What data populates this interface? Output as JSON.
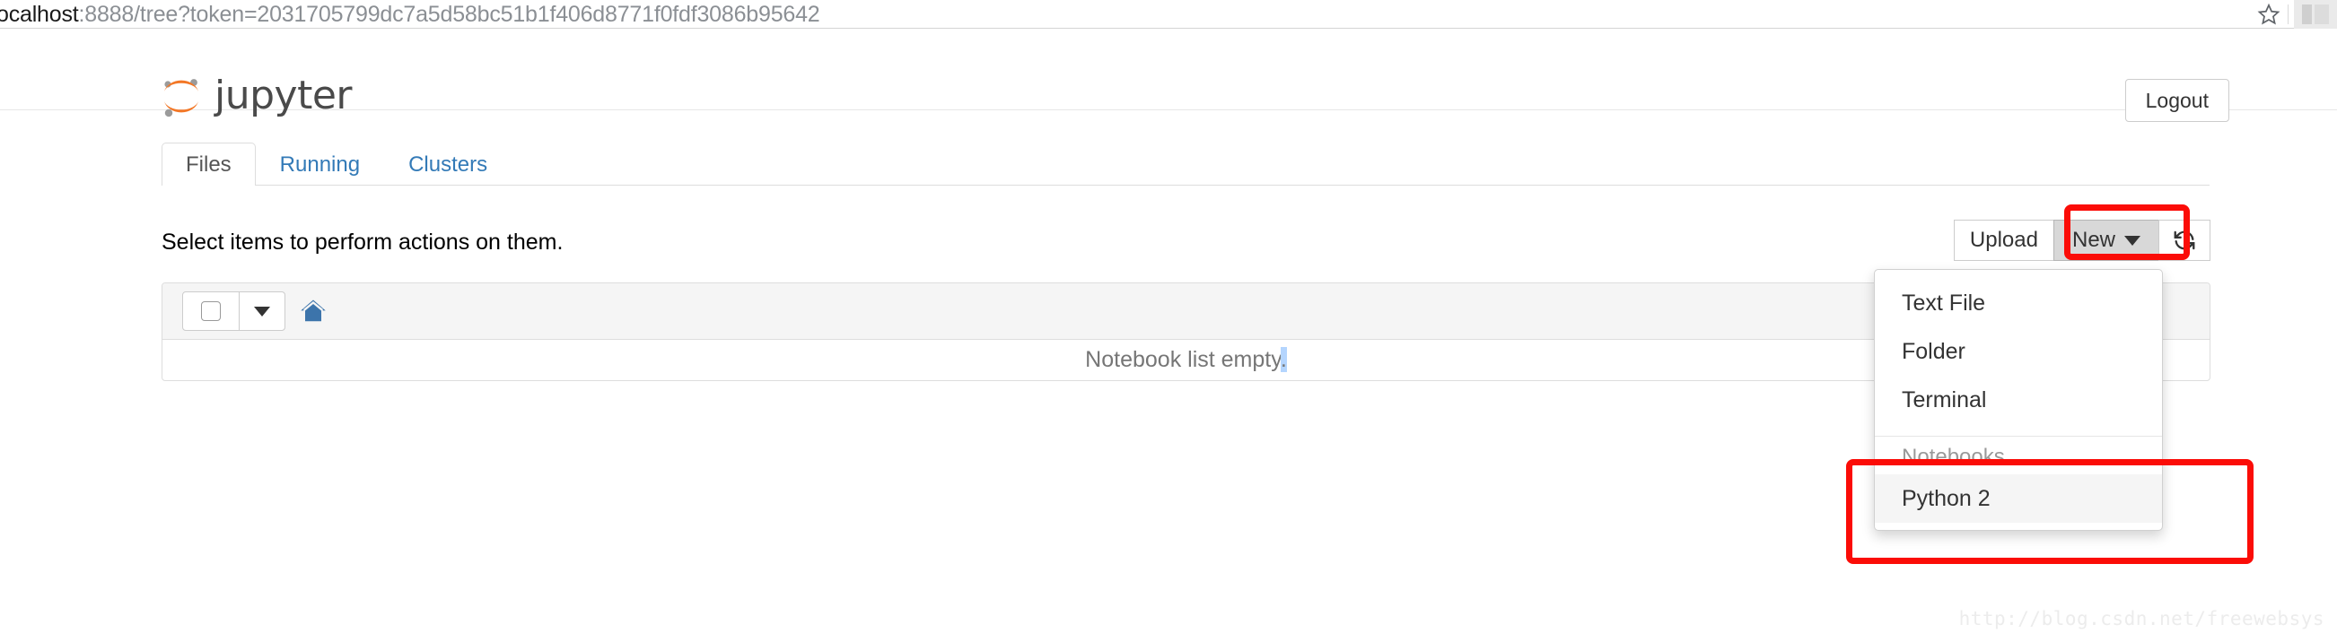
{
  "browser": {
    "url_host": "ocalhost",
    "url_rest": ":8888/tree?token=2031705799dc7a5d58bc51b1f406d8771f0fdf3086b95642",
    "star_icon": "star-icon",
    "panel_icon": "browser-panel-icon"
  },
  "header": {
    "brand": "jupyter",
    "logo_icon": "jupyter-logo-icon",
    "logout_label": "Logout"
  },
  "tabs": [
    {
      "label": "Files",
      "active": true
    },
    {
      "label": "Running",
      "active": false
    },
    {
      "label": "Clusters",
      "active": false
    }
  ],
  "toolbar": {
    "select_hint": "Select items to perform actions on them.",
    "upload_label": "Upload",
    "new_label": "New",
    "new_caret_icon": "chevron-down-icon",
    "refresh_icon": "refresh-icon"
  },
  "file_list": {
    "select_all_checkbox": "select-all-checkbox",
    "select_caret_icon": "chevron-down-icon",
    "home_icon": "home-icon",
    "empty_message": "Notebook list empty",
    "empty_message_selected": "."
  },
  "new_menu": {
    "items": [
      {
        "label": "Text File",
        "highlight": false
      },
      {
        "label": "Folder",
        "highlight": false
      },
      {
        "label": "Terminal",
        "highlight": false
      }
    ],
    "section_header": "Notebooks",
    "kernels": [
      {
        "label": "Python 2",
        "highlight": true
      }
    ]
  },
  "annotations": {
    "new_button_box": "red-highlight-new-button",
    "python2_box": "red-highlight-python2"
  },
  "watermark": "http://blog.csdn.net/freewebsys",
  "colors": {
    "accent_orange": "#f37726",
    "link_blue": "#337ab7",
    "annotation_red": "#fb0c07",
    "selection_blue": "#b4d5fe"
  }
}
